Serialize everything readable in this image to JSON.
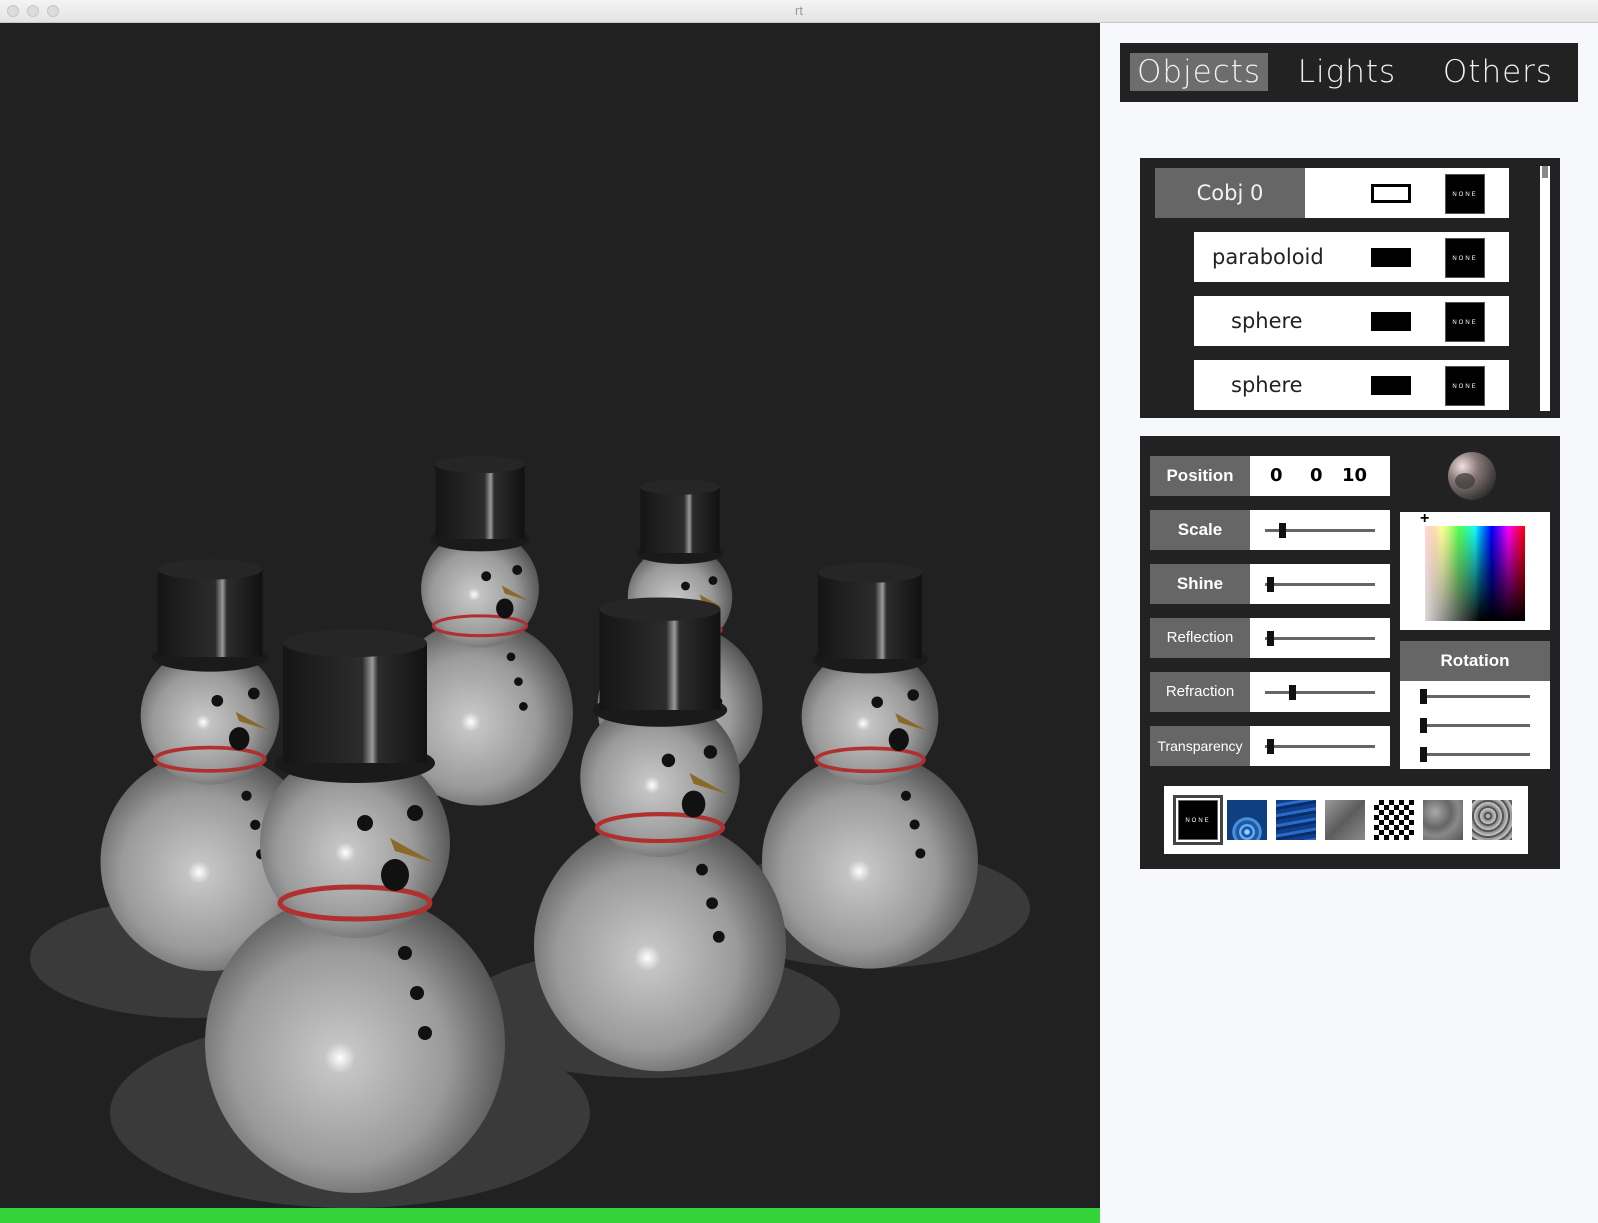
{
  "window": {
    "title": "rt"
  },
  "render": {
    "progress": 1.0,
    "progress_color": "#35d33a"
  },
  "tabs": [
    {
      "label": "Objects",
      "active": true
    },
    {
      "label": "Lights",
      "active": false
    },
    {
      "label": "Others",
      "active": false
    }
  ],
  "object_list": {
    "items": [
      {
        "name": "Cobj 0",
        "kind": "group",
        "texture": "NONE"
      },
      {
        "name": "paraboloid",
        "kind": "child",
        "texture": "NONE"
      },
      {
        "name": "sphere",
        "kind": "child",
        "texture": "NONE"
      },
      {
        "name": "sphere",
        "kind": "child",
        "texture": "NONE"
      }
    ]
  },
  "properties": {
    "position": {
      "label": "Position",
      "x": "0",
      "y": "0",
      "z": "10"
    },
    "scale": {
      "label": "Scale",
      "value": 0.12
    },
    "shine": {
      "label": "Shine",
      "value": 0.0
    },
    "reflection": {
      "label": "Reflection",
      "value": 0.0
    },
    "refraction": {
      "label": "Refraction",
      "value": 0.22
    },
    "transparency": {
      "label": "Transparency",
      "value": 0.0
    }
  },
  "color_picker": {
    "cursor": "+"
  },
  "rotation": {
    "label": "Rotation",
    "values": [
      0.0,
      0.0,
      0.0
    ]
  },
  "textures": [
    {
      "id": "none",
      "label": "NONE",
      "selected": true
    },
    {
      "id": "ripple",
      "label": "",
      "selected": false
    },
    {
      "id": "water",
      "label": "",
      "selected": false
    },
    {
      "id": "metal",
      "label": "",
      "selected": false
    },
    {
      "id": "checker",
      "label": "",
      "selected": false
    },
    {
      "id": "stone",
      "label": "",
      "selected": false
    },
    {
      "id": "noise",
      "label": "",
      "selected": false
    }
  ]
}
